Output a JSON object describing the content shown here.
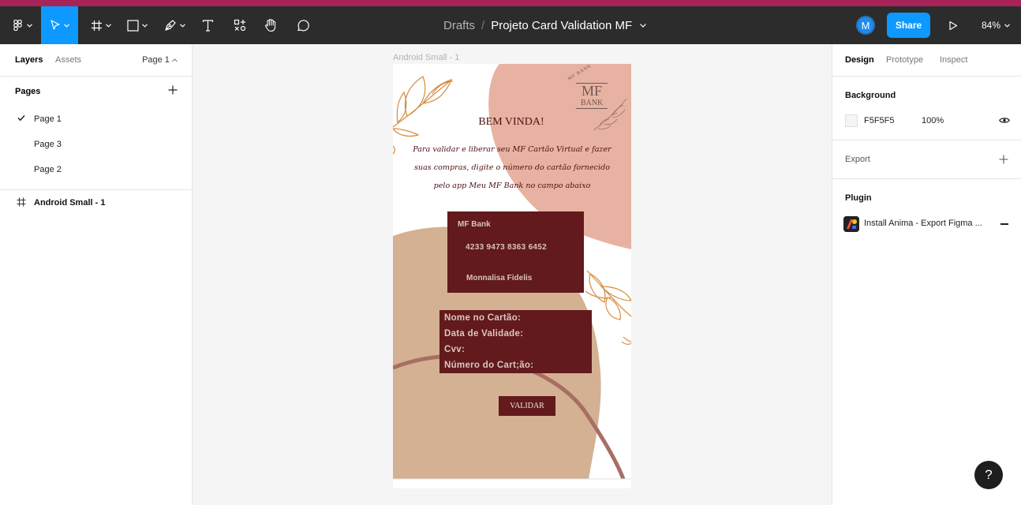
{
  "toolbar": {
    "breadcrumb_root": "Drafts",
    "file_name": "Projeto Card Validation MF",
    "avatar_initial": "M",
    "share_label": "Share",
    "zoom": "84%"
  },
  "left_panel": {
    "tabs": [
      "Layers",
      "Assets"
    ],
    "current_page": "Page 1",
    "pages_title": "Pages",
    "pages": [
      {
        "label": "Page 1",
        "selected": true
      },
      {
        "label": "Page 3",
        "selected": false
      },
      {
        "label": "Page 2",
        "selected": false
      }
    ],
    "layers": [
      {
        "label": "Android Small - 1",
        "icon": "frame-icon"
      }
    ]
  },
  "canvas": {
    "frame_label": "Android Small - 1",
    "design": {
      "logo_arc": "MF BANK",
      "logo_main": "MF",
      "logo_sub": "BANK",
      "heading": "BEM VINDA!",
      "intro_lines": [
        "Para validar e liberar seu MF Cartão Virtual e fazer",
        "suas compras, digite o número do cartão fornecido",
        "pelo app Meu MF Bank  no campo abaixo"
      ],
      "card_bank": "MF Bank",
      "card_number": "4233 9473 8363 6452",
      "card_holder": "Monnalisa Fidelis",
      "form_fields": [
        "Nome no Cartão:",
        "Data de Validade:",
        "Cvv:",
        "Número do Cart;ão:"
      ],
      "validate_button": "VALIDAR",
      "colors": {
        "blush": "#e8b2a2",
        "tan": "#d4b193",
        "maroon": "#621a1c",
        "leaf": "#d58b3c"
      }
    }
  },
  "right_panel": {
    "tabs": [
      "Design",
      "Prototype",
      "Inspect"
    ],
    "background_title": "Background",
    "background_hex": "F5F5F5",
    "background_opacity": "100%",
    "export_title": "Export",
    "plugin_title": "Plugin",
    "plugin_name": "Install Anima - Export Figma ..."
  },
  "help_label": "?"
}
